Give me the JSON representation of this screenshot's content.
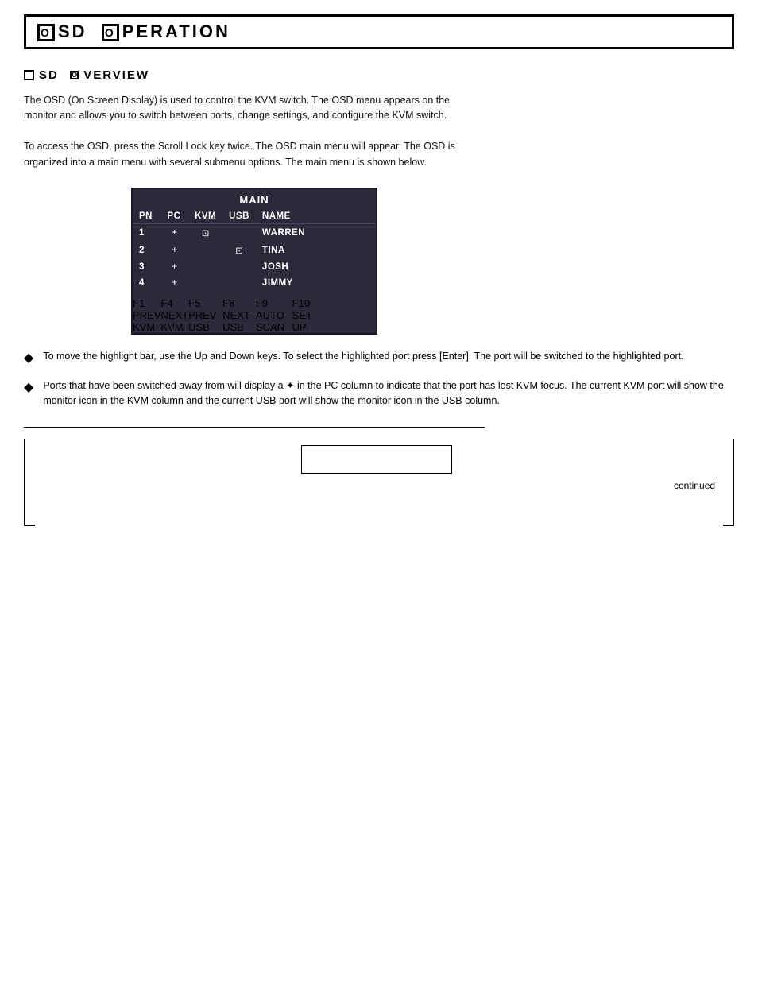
{
  "header": {
    "title": "OSD Operation",
    "title_display": "SD  PERATION"
  },
  "section": {
    "title": "SD  VERVIEW",
    "title_display": "OSD Overview"
  },
  "body_paragraphs": [
    "The OSD (On Screen Display) is used to control the KVM switch. The OSD menu appears on the monitor and allows you to switch between ports, change settings, and configure the KVM switch.",
    "To access the OSD, press the Scroll Lock key twice. The OSD main menu will appear. The OSD is organized into a main menu with several submenu options. The main menu is shown below."
  ],
  "osd_table": {
    "main_title": "MAIN",
    "headers": [
      "PN",
      "PC",
      "KVM",
      "USB",
      "NAME"
    ],
    "rows": [
      {
        "pn": "1",
        "pc": "+",
        "kvm": "⊡",
        "usb": "",
        "name": "WARREN"
      },
      {
        "pn": "2",
        "pc": "+",
        "kvm": "",
        "usb": "⊡",
        "name": "TINA"
      },
      {
        "pn": "3",
        "pc": "+",
        "kvm": "",
        "usb": "",
        "name": "JOSH"
      },
      {
        "pn": "4",
        "pc": "+",
        "kvm": "",
        "usb": "",
        "name": "JIMMY"
      }
    ],
    "footer_keys": [
      {
        "key": "F1",
        "label": "PREV\nKVM"
      },
      {
        "key": "F4",
        "label": "NEXT\nKVM"
      },
      {
        "key": "F5",
        "label": "PREV\nUSB"
      },
      {
        "key": "F8",
        "label": "NEXT\nUSB"
      },
      {
        "key": "F9",
        "label": "AUTO\nSCAN"
      },
      {
        "key": "F10",
        "label": "SET\nUP"
      }
    ]
  },
  "bullet_points": [
    "To move the highlight bar, use the Up and Down keys. To select the highlighted port press [Enter]. The port will be switched to the highlighted port.",
    "Ports that have been switched away from will display a ✦ in the PC column to indicate that the port has lost KVM focus. The current KVM port will show the monitor icon in the KVM column and the current USB port will show the monitor icon in the USB column."
  ],
  "footer": {
    "rule_text": "",
    "center_box_label": "",
    "right_text": "continued",
    "page_text": ""
  }
}
